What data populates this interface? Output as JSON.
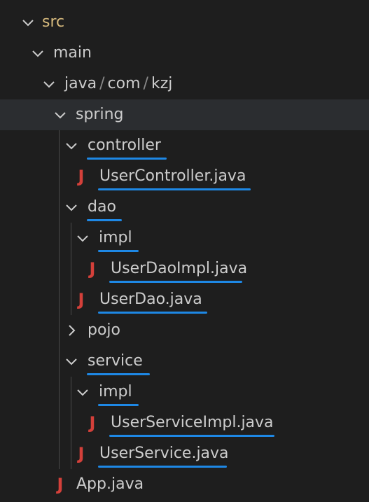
{
  "explorer": {
    "src": "src",
    "main": "main",
    "path": {
      "java": "java",
      "com": "com",
      "kzj": "kzj",
      "separator": "/"
    },
    "spring": "spring",
    "controller": "controller",
    "user_controller": "UserController.java",
    "dao": "dao",
    "dao_impl": "impl",
    "user_dao_impl": "UserDaoImpl.java",
    "user_dao": "UserDao.java",
    "pojo": "pojo",
    "service": "service",
    "service_impl": "impl",
    "user_service_impl": "UserServiceImpl.java",
    "user_service": "UserService.java",
    "app": "App.java"
  },
  "icons": {
    "java_file_icon": "J",
    "expanded": "chevron-down-icon",
    "collapsed": "chevron-right-icon"
  },
  "colors": {
    "background": "#1e1e1e",
    "selected_row": "#2b2d30",
    "java_icon": "#d4403a",
    "src_label": "#d7ba7d",
    "annotation_underline": "#1e88e5"
  }
}
